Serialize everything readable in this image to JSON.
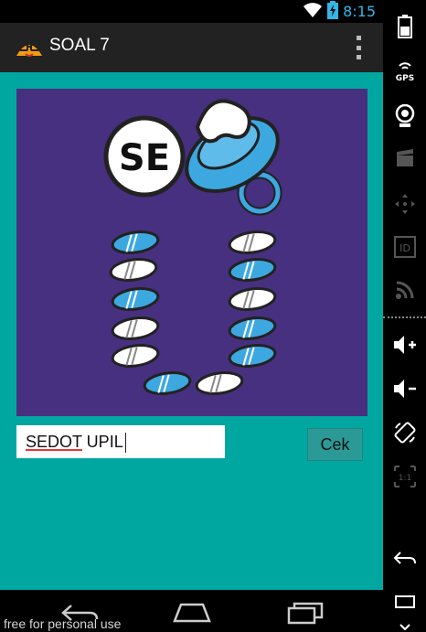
{
  "status_bar": {
    "time": "8:15"
  },
  "action_bar": {
    "title": "SOAL 7",
    "app_icon": "mascot-icon",
    "menu_icon": "overflow-menu-icon"
  },
  "puzzle": {
    "badge_text": "SE",
    "alt_icons": [
      "pacifier-icon",
      "pills-icon"
    ]
  },
  "answer": {
    "value": "SEDOT UPIL"
  },
  "buttons": {
    "check_label": "Cek"
  },
  "nav_bar": {
    "icons": [
      "back-icon",
      "home-icon",
      "recent-apps-icon"
    ]
  },
  "watermark": "free for personal use",
  "side_panel": {
    "gps_label": "GPS",
    "id_label": "ID",
    "scale_label": "1:1"
  },
  "colors": {
    "accent_teal": "#00a7a1",
    "puzzle_bg": "#46307f",
    "clock_blue": "#33b5e5",
    "pill_blue": "#3da8e0"
  }
}
